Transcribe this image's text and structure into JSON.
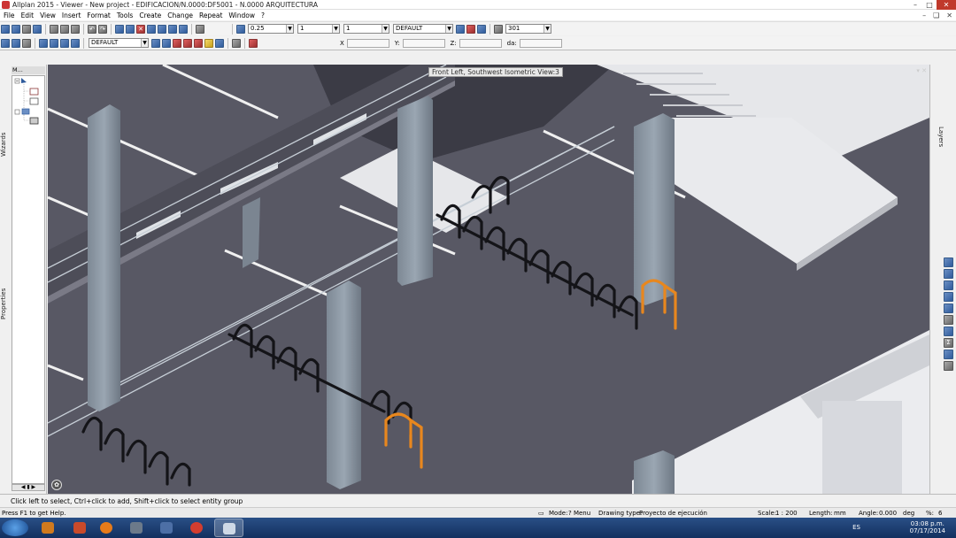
{
  "window": {
    "title": "Allplan 2015 - Viewer - New project - EDIFICACION/N.0000:DF5001 - N.0000 ARQUITECTURA"
  },
  "menu": [
    "File",
    "Edit",
    "View",
    "Insert",
    "Format",
    "Tools",
    "Create",
    "Change",
    "Repeat",
    "Window",
    "?"
  ],
  "toolbar": {
    "pen_thickness": "0.25",
    "line_type": "1",
    "line_color": "1",
    "layer_top": "DEFAULT",
    "layer_left": "DEFAULT",
    "pattern_value": "301",
    "coord_labels": [
      "X",
      "Y:",
      "Z:",
      "da:"
    ]
  },
  "left_panel": {
    "header": "M...",
    "tabs": [
      "Wizards",
      "Properties"
    ]
  },
  "viewport": {
    "view_label": "Front Left, Southwest Isometric View:3",
    "colors": {
      "floor": "#585864",
      "slab": "#e6e7ea",
      "column": "#8e9aa6",
      "rail": "#bac3cc",
      "rack": "#1a1a1e",
      "rack_orange": "#e8871e"
    }
  },
  "right_panel": {
    "tab": "Layers"
  },
  "command_line": {
    "prompt": "Click left to select, Ctrl+click to add, Shift+click to select entity group"
  },
  "status_bar": {
    "help": "Press F1 to get Help.",
    "mode_label": "Mode:",
    "mode_value": "? Menu",
    "drawing_type_label": "Drawing type:",
    "drawing_type_value": "Proyecto de ejecución",
    "scale_label": "Scale:",
    "scale_value": "1 : 200",
    "length_label": "Length:",
    "length_value": "mm",
    "angle_label": "Angle:",
    "angle_value": "0.000",
    "angle_unit": "deg",
    "percent_label": "%:",
    "percent_value": "6"
  },
  "taskbar": {
    "language": "ES",
    "time": "03:08 p.m.",
    "date": "07/17/2014",
    "apps": [
      "media-player",
      "firefox",
      "network",
      "allplan-tool",
      "chrome",
      "allplan"
    ]
  }
}
